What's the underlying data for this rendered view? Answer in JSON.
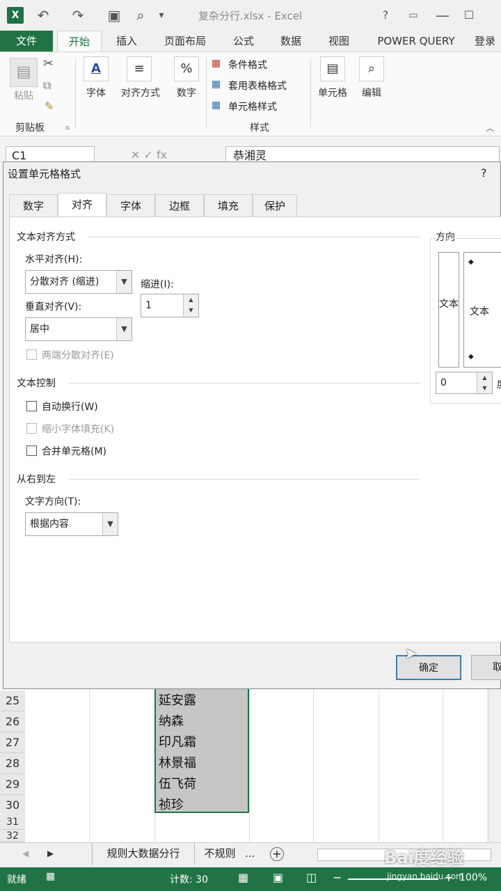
{
  "titlebar": {
    "doc_title": "复杂分行.xlsx - Excel",
    "logo": "X",
    "help": "?"
  },
  "ribbon_tabs": [
    "文件",
    "开始",
    "插入",
    "页面布局",
    "公式",
    "数据",
    "视图",
    "POWER QUERY",
    "登录"
  ],
  "ribbon": {
    "paste": "粘贴",
    "clipboard_group": "剪贴板",
    "font": "字体",
    "alignment": "对齐方式",
    "number": "数字",
    "cond_format": "条件格式",
    "table_format": "套用表格格式",
    "cell_style": "单元格样式",
    "styles_group": "样式",
    "cells": "单元格",
    "editing": "编辑"
  },
  "formula_bar": {
    "name_box": "C1",
    "content": "恭湘灵"
  },
  "dialog": {
    "title": "设置单元格格式",
    "help": "?",
    "tabs": [
      "数字",
      "对齐",
      "字体",
      "边框",
      "填充",
      "保护"
    ],
    "text_align_section": "文本对齐方式",
    "horizontal_label": "水平对齐(H):",
    "horizontal_value": "分散对齐 (缩进)",
    "indent_label": "缩进(I):",
    "indent_value": "1",
    "vertical_label": "垂直对齐(V):",
    "vertical_value": "居中",
    "justify_distributed": "两端分散对齐(E)",
    "text_control_section": "文本控制",
    "wrap_text": "自动换行(W)",
    "shrink_fit": "缩小字体填充(K)",
    "merge_cells": "合并单元格(M)",
    "rtl_section": "从右到左",
    "direction_label": "文字方向(T):",
    "direction_value": "根据内容",
    "orientation_section": "方向",
    "orientation_vertical_text": "文本",
    "orientation_text": "文本",
    "degrees_value": "0",
    "degrees_unit": "度",
    "ok": "确定",
    "cancel": "取"
  },
  "grid": {
    "rows": [
      {
        "num": "25",
        "name": "延安露"
      },
      {
        "num": "26",
        "name": "纳森"
      },
      {
        "num": "27",
        "name": "印凡霜"
      },
      {
        "num": "28",
        "name": "林景福"
      },
      {
        "num": "29",
        "name": "伍飞荷"
      },
      {
        "num": "30",
        "name": "祯珍"
      },
      {
        "num": "31",
        "name": ""
      },
      {
        "num": "32",
        "name": ""
      }
    ]
  },
  "sheet_tabs": {
    "tab1": "规则大数据分行",
    "tab2": "不规则",
    "more": "..."
  },
  "status": {
    "ready": "就绪",
    "count": "计数: 30",
    "zoom": "100%"
  },
  "watermark": {
    "brand": "Bai度经验",
    "url": "jingyan.baidu.com"
  }
}
